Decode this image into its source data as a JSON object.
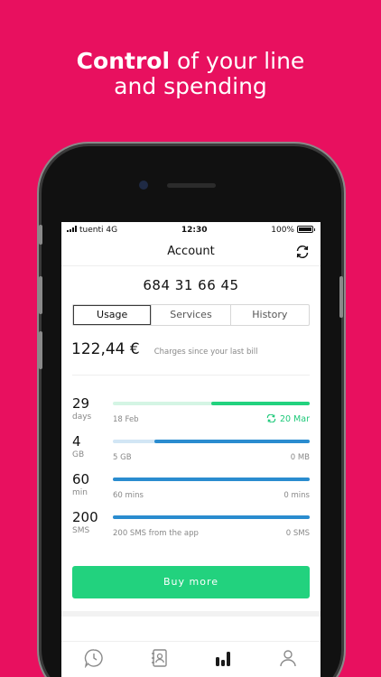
{
  "headline": {
    "bold": "Control",
    "rest": " of your line",
    "line2": "and spending"
  },
  "status_bar": {
    "carrier": "tuenti",
    "network": "4G",
    "time": "12:30",
    "battery": "100%"
  },
  "nav": {
    "title": "Account",
    "refresh_icon": "refresh-icon"
  },
  "account": {
    "phone_number": "684 31 66 45"
  },
  "tabs": [
    {
      "label": "Usage",
      "active": true
    },
    {
      "label": "Services",
      "active": false
    },
    {
      "label": "History",
      "active": false
    }
  ],
  "charges": {
    "amount": "122,44 €",
    "note": "Charges since your last bill"
  },
  "usage": [
    {
      "value": "29",
      "unit": "days",
      "left": "18 Feb",
      "right": "20 Mar",
      "remaining_fraction": 0.5,
      "track_color": "#d4f5e4",
      "fill_color": "#22d27e",
      "right_icon": "renew-icon"
    },
    {
      "value": "4",
      "unit": "GB",
      "left": "5 GB",
      "right": "0 MB",
      "remaining_fraction": 0.79,
      "track_color": "#d2e6f5",
      "fill_color": "#2a8ccf"
    },
    {
      "value": "60",
      "unit": "min",
      "left": "60 mins",
      "right": "0 mins",
      "remaining_fraction": 1.0,
      "track_color": "#d2e6f5",
      "fill_color": "#2a8ccf"
    },
    {
      "value": "200",
      "unit": "SMS",
      "left": "200 SMS from the app",
      "right": "0 SMS",
      "remaining_fraction": 1.0,
      "track_color": "#d2e6f5",
      "fill_color": "#2a8ccf"
    }
  ],
  "buy_button": {
    "label": "Buy more"
  },
  "tab_bar": [
    {
      "icon": "clock-chat-icon",
      "active": false
    },
    {
      "icon": "contacts-icon",
      "active": false
    },
    {
      "icon": "bar-chart-icon",
      "active": true
    },
    {
      "icon": "profile-icon",
      "active": false
    }
  ],
  "colors": {
    "background": "#e8105f",
    "accent_green": "#22d27e",
    "accent_blue": "#2a8ccf"
  }
}
